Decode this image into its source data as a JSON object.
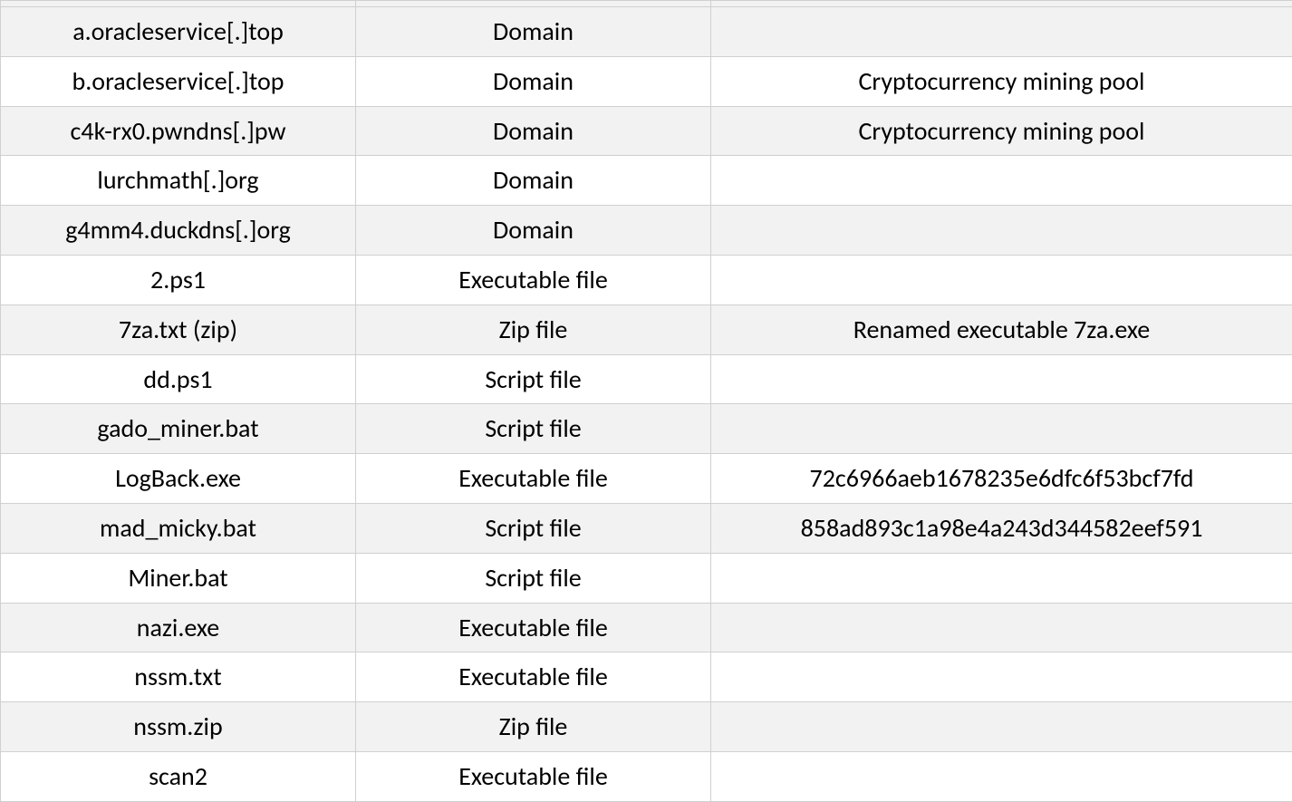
{
  "table": {
    "rows": [
      {
        "indicator": "a.oracleservice[.]top",
        "type": "Domain",
        "details": ""
      },
      {
        "indicator": "b.oracleservice[.]top",
        "type": "Domain",
        "details": "Cryptocurrency mining pool"
      },
      {
        "indicator": "c4k-rx0.pwndns[.]pw",
        "type": "Domain",
        "details": "Cryptocurrency mining pool"
      },
      {
        "indicator": "lurchmath[.]org",
        "type": "Domain",
        "details": ""
      },
      {
        "indicator": "g4mm4.duckdns[.]org",
        "type": "Domain",
        "details": ""
      },
      {
        "indicator": "2.ps1",
        "type": "Executable file",
        "details": ""
      },
      {
        "indicator": "7za.txt (zip)",
        "type": "Zip file",
        "details": "Renamed executable 7za.exe"
      },
      {
        "indicator": "dd.ps1",
        "type": "Script file",
        "details": ""
      },
      {
        "indicator": "gado_miner.bat",
        "type": "Script file",
        "details": ""
      },
      {
        "indicator": "LogBack.exe",
        "type": "Executable file",
        "details": "72c6966aeb1678235e6dfc6f53bcf7fd"
      },
      {
        "indicator": "mad_micky.bat",
        "type": "Script file",
        "details": "858ad893c1a98e4a243d344582eef591"
      },
      {
        "indicator": "Miner.bat",
        "type": "Script file",
        "details": ""
      },
      {
        "indicator": "nazi.exe",
        "type": "Executable file",
        "details": ""
      },
      {
        "indicator": "nssm.txt",
        "type": "Executable file",
        "details": ""
      },
      {
        "indicator": "nssm.zip",
        "type": "Zip file",
        "details": ""
      },
      {
        "indicator": "scan2",
        "type": "Executable file",
        "details": ""
      }
    ]
  }
}
